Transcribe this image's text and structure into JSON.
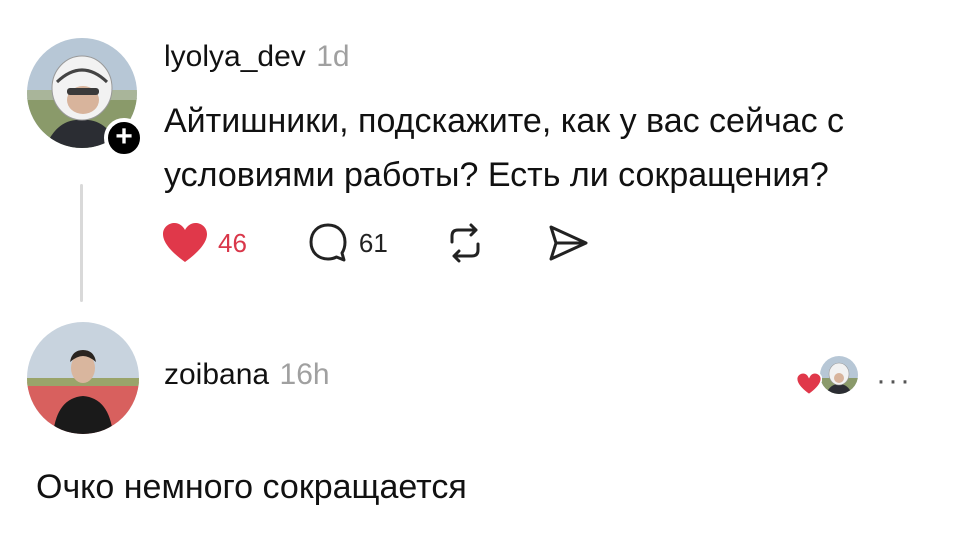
{
  "post": {
    "username": "lyolya_dev",
    "time": "1d",
    "text": "Айтишники, подскажите, как у вас сейчас с условиями работы? Есть ли сокращения?",
    "likes": "46",
    "replies": "61",
    "liked": true,
    "accent_like": "#e0384a"
  },
  "reply": {
    "username": "zoibana",
    "time": "16h",
    "text": "Очко немного сокращается",
    "more_label": "···"
  },
  "icons": {
    "follow": "plus-icon",
    "like": "heart-icon",
    "reply": "comment-icon",
    "repost": "repost-icon",
    "share": "send-icon",
    "more": "more-icon"
  }
}
